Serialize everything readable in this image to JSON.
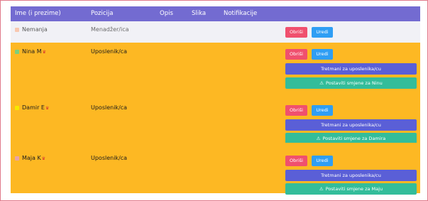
{
  "colors": {
    "header": "#736bd1",
    "row_active": "#fdb823",
    "row_muted": "#f1f1f6",
    "delete": "#f0506e",
    "edit": "#2f9ef4",
    "treatments": "#5a5fd7",
    "shifts": "#33bd9a"
  },
  "header": {
    "name": "Ime (i prezime)",
    "position": "Pozicija",
    "description": "Opis",
    "image": "Slika",
    "notifications": "Notifikacije"
  },
  "rows": [
    {
      "name": "Nemanja",
      "position": "Menadžer/ica",
      "swatch_color": "#f8c7b0",
      "delete_label": "Obriši",
      "edit_label": "Uredi"
    },
    {
      "name": "Nina M",
      "position": "Uposlenik/ca",
      "swatch_color": "#7ccf7c",
      "delete_label": "Obriši",
      "edit_label": "Uredi",
      "treatments_label": "Tretmani za uposlenika/cu",
      "shifts_label": "Postaviti smjene za Ninu"
    },
    {
      "name": "Damir E",
      "position": "Uposlenik/ca",
      "swatch_color": "#f6e800",
      "delete_label": "Obriši",
      "edit_label": "Uredi",
      "treatments_label": "Tretmani za uposlenika/cu",
      "shifts_label": "Postaviti smjene za Damira"
    },
    {
      "name": "Maja K",
      "position": "Uposlenik/ca",
      "swatch_color": "#e8a3a8",
      "delete_label": "Obriši",
      "edit_label": "Uredi",
      "treatments_label": "Tretmani za uposlenika/cu",
      "shifts_label": "Postaviti smjene za Maju"
    }
  ],
  "icons": {
    "crown": "crown-icon",
    "warning": "warning-icon"
  }
}
